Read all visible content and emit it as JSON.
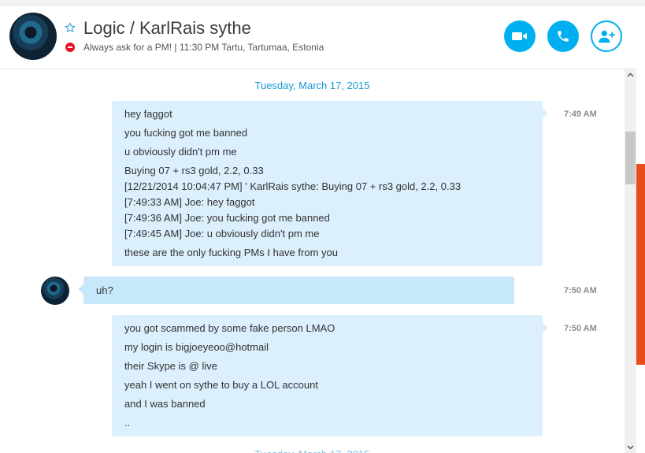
{
  "header": {
    "group": "Logic",
    "separator": "/",
    "contact": "KarlRais sythe",
    "mood": "Always ask for a PM!  |  11:30 PM Tartu, Tartumaa, Estonia",
    "icons": [
      "star-icon",
      "do-not-disturb-icon",
      "video-call-icon",
      "audio-call-icon",
      "add-person-icon"
    ],
    "accent_color": "#00aff0"
  },
  "chat": {
    "date_label": "Tuesday, March 17, 2015",
    "messages": [
      {
        "direction": "outgoing",
        "time": "7:49 AM",
        "lines": [
          "hey faggot",
          "you fucking got me banned",
          "u obviously didn't pm me",
          "Buying 07 + rs3 gold, 2.2, 0.33",
          "[12/21/2014 10:04:47 PM] '      KarlRais sythe: Buying 07 + rs3 gold, 2.2, 0.33",
          "[7:49:33 AM] Joe: hey faggot",
          "[7:49:36 AM] Joe: you fucking got me banned",
          "[7:49:45 AM] Joe: u obviously didn't pm me",
          "these are the only fucking PMs I have from you"
        ]
      },
      {
        "direction": "incoming",
        "time": "7:50 AM",
        "lines": [
          "uh?"
        ]
      },
      {
        "direction": "outgoing",
        "time": "7:50 AM",
        "lines": [
          "you got scammed by some fake person LMAO",
          "my login is bigjoeyeoo@hotmail",
          "their Skype is @ live",
          "yeah I went on sythe to buy a LOL account",
          "and I was banned",
          ".."
        ]
      }
    ]
  }
}
